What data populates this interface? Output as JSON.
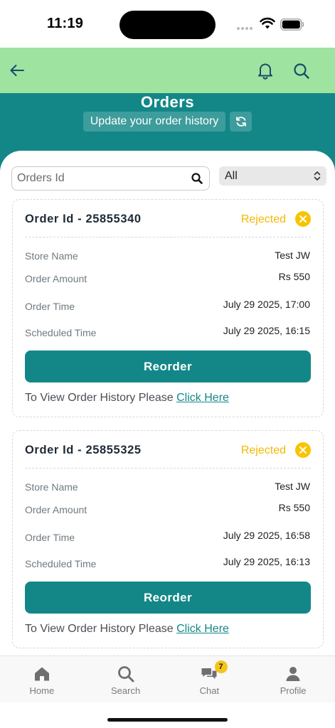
{
  "status_bar": {
    "time": "11:19"
  },
  "header": {
    "title": "Orders",
    "update_label": "Update your order history"
  },
  "filters": {
    "search_placeholder": "Orders Id",
    "selected_option": "All"
  },
  "labels": {
    "store_name": "Store Name",
    "order_amount": "Order Amount",
    "order_time": "Order Time",
    "scheduled_time": "Scheduled Time",
    "reorder": "Reorder",
    "history_prefix": "To View Order History Please ",
    "history_link": "Click Here"
  },
  "orders": [
    {
      "order_id": "Order Id - 25855340",
      "status": "Rejected",
      "store_name": "Test JW",
      "amount": "Rs 550",
      "order_time": "July 29 2025, 17:00",
      "scheduled_time": "July 29 2025, 16:15"
    },
    {
      "order_id": "Order Id - 25855325",
      "status": "Rejected",
      "store_name": "Test JW",
      "amount": "Rs 550",
      "order_time": "July 29 2025, 16:58",
      "scheduled_time": "July 29 2025, 16:13"
    }
  ],
  "bottom_nav": {
    "items": [
      {
        "label": "Home",
        "icon": "home-icon"
      },
      {
        "label": "Search",
        "icon": "search-icon"
      },
      {
        "label": "Chat",
        "icon": "chat-icon",
        "badge": "7"
      },
      {
        "label": "Profile",
        "icon": "profile-icon"
      }
    ]
  },
  "colors": {
    "app_bar": "#9fe3a0",
    "header_teal": "#138787",
    "status_rejected": "#f5b800"
  }
}
